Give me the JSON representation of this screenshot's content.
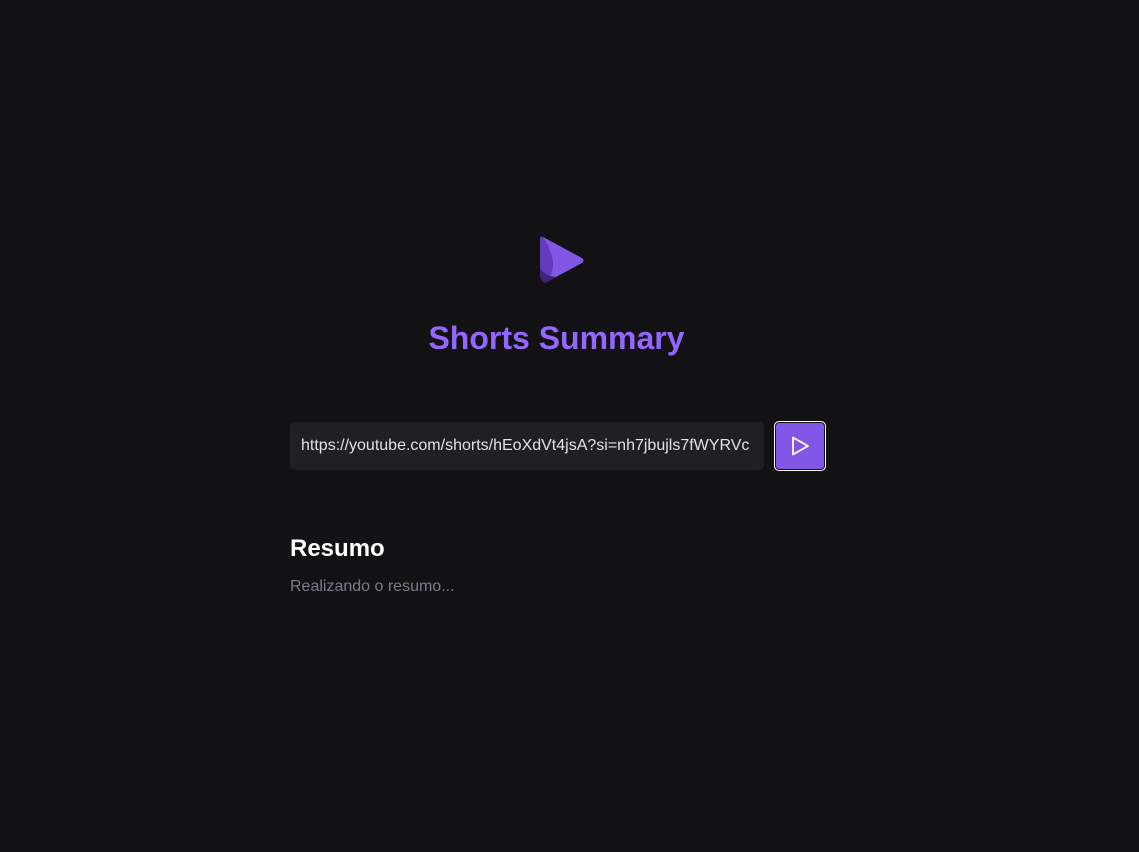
{
  "header": {
    "logo_icon": "play-triangle-icon",
    "title": "Shorts Summary"
  },
  "form": {
    "url_value": "https://youtube.com/shorts/hEoXdVt4jsA?si=nh7jbujls7fWYRVc",
    "submit_icon": "play-icon"
  },
  "summary": {
    "heading": "Resumo",
    "status": "Realizando o resumo..."
  },
  "colors": {
    "background": "#121214",
    "accent": "#8257e5",
    "title": "#9466ff",
    "input_bg": "#202024",
    "muted_text": "#7c7c8a"
  }
}
